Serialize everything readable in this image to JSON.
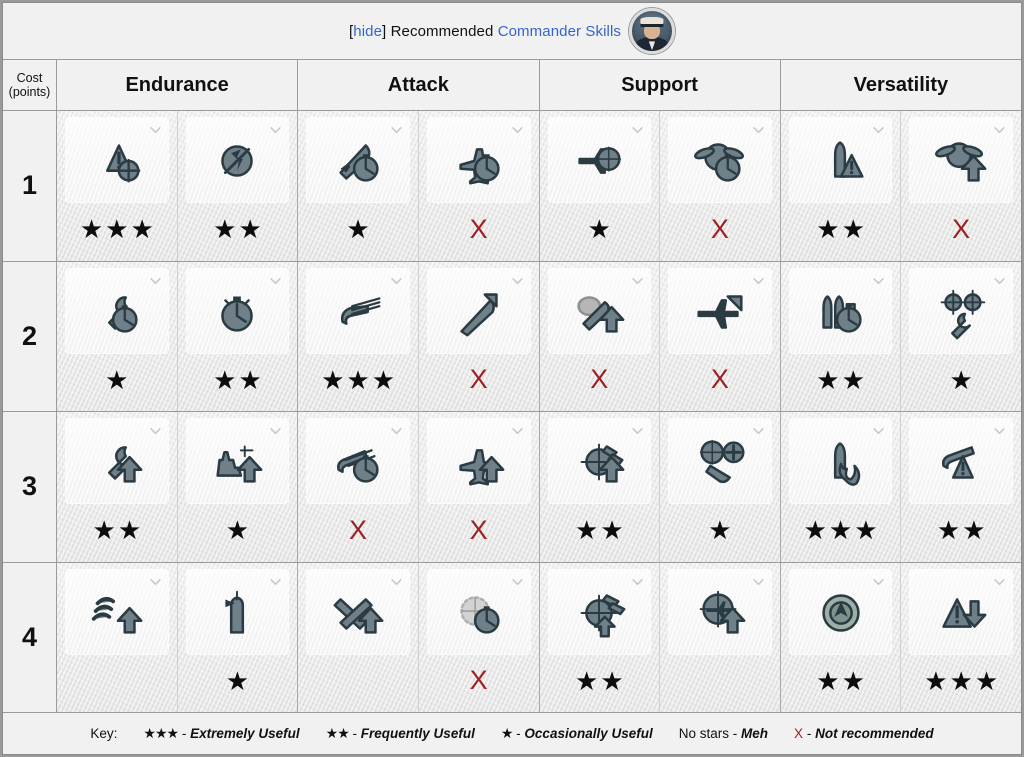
{
  "header": {
    "hide_label": "hide",
    "bracket_open": "[",
    "bracket_close": "]",
    "title_middle": " Recommended ",
    "link_label": "Commander Skills",
    "avatar_name": "commander-avatar",
    "link_color": "#3366cc"
  },
  "columns": {
    "cost_header_line1": "Cost",
    "cost_header_line2": "(points)",
    "categories": [
      "Endurance",
      "Attack",
      "Support",
      "Versatility"
    ]
  },
  "legend": {
    "key_label": "Key:",
    "items": [
      {
        "symbol": "★★★",
        "dash": "-",
        "desc": "Extremely Useful",
        "type": "stars"
      },
      {
        "symbol": "★★",
        "dash": "-",
        "desc": "Frequently Useful",
        "type": "stars"
      },
      {
        "symbol": "★",
        "dash": "-",
        "desc": "Occasionally Useful",
        "type": "stars"
      },
      {
        "symbol": "No stars",
        "dash": "-",
        "desc": "Meh",
        "type": "text"
      },
      {
        "symbol": "X",
        "dash": "-",
        "desc": "Not recommended",
        "type": "x"
      }
    ]
  },
  "colors": {
    "link": "#3366cc",
    "x_mark": "#9d1f1f",
    "star": "#0d0d0d",
    "grid_line": "#9b9b9b",
    "page_bg": "#9a9a9a",
    "panel_bg": "#f1f1f1",
    "icon_fill": "#6f8089",
    "icon_stroke": "#2b3b43"
  },
  "rows": [
    {
      "cost": "1",
      "cells": [
        {
          "icon": "priority-target-icon",
          "rating": "★★★",
          "stars": 3,
          "mark": ""
        },
        {
          "icon": "preventive-maintenance-icon",
          "rating": "★★",
          "stars": 2,
          "mark": ""
        },
        {
          "icon": "torpedo-armament-expertise-icon",
          "rating": "★",
          "stars": 1,
          "mark": ""
        },
        {
          "icon": "air-supremacy-icon",
          "rating": "X",
          "stars": 0,
          "mark": "X"
        },
        {
          "icon": "direction-center-for-fighters-icon",
          "rating": "★",
          "stars": 1,
          "mark": ""
        },
        {
          "icon": "improved-engine-boost-icon",
          "rating": "X",
          "stars": 0,
          "mark": "X"
        },
        {
          "icon": "incoming-fire-alert-icon",
          "rating": "★★",
          "stars": 2,
          "mark": ""
        },
        {
          "icon": "last-gasp-icon",
          "rating": "X",
          "stars": 0,
          "mark": "X"
        }
      ]
    },
    {
      "cost": "2",
      "cells": [
        {
          "icon": "emergency-repair-specialist-icon",
          "rating": "★",
          "stars": 1,
          "mark": ""
        },
        {
          "icon": "adrenaline-rush-icon",
          "rating": "★★",
          "stars": 2,
          "mark": ""
        },
        {
          "icon": "main-battery-expert-icon",
          "rating": "★★★",
          "stars": 3,
          "mark": ""
        },
        {
          "icon": "torpedo-acceleration-icon",
          "rating": "X",
          "stars": 0,
          "mark": "X"
        },
        {
          "icon": "smoke-screen-expert-icon",
          "rating": "X",
          "stars": 0,
          "mark": "X"
        },
        {
          "icon": "improved-engines-icon",
          "rating": "X",
          "stars": 0,
          "mark": "X"
        },
        {
          "icon": "expert-loader-icon",
          "rating": "★★",
          "stars": 2,
          "mark": ""
        },
        {
          "icon": "jack-of-all-trades-icon",
          "rating": "★",
          "stars": 1,
          "mark": ""
        }
      ]
    },
    {
      "cost": "3",
      "cells": [
        {
          "icon": "basics-of-survivability-icon",
          "rating": "★★",
          "stars": 2,
          "mark": ""
        },
        {
          "icon": "survivability-expert-icon",
          "rating": "★",
          "stars": 1,
          "mark": ""
        },
        {
          "icon": "main-battery-reload-icon",
          "rating": "X",
          "stars": 0,
          "mark": "X"
        },
        {
          "icon": "torpedo-bomber-icon",
          "rating": "X",
          "stars": 0,
          "mark": "X"
        },
        {
          "icon": "aircraft-armor-icon",
          "rating": "★★",
          "stars": 2,
          "mark": ""
        },
        {
          "icon": "aircraft-repair-icon",
          "rating": "★",
          "stars": 1,
          "mark": ""
        },
        {
          "icon": "demolition-expert-icon",
          "rating": "★★★",
          "stars": 3,
          "mark": ""
        },
        {
          "icon": "inertia-fuse-he-icon",
          "rating": "★★",
          "stars": 2,
          "mark": ""
        }
      ]
    },
    {
      "cost": "4",
      "cells": [
        {
          "icon": "fire-prevention-icon",
          "rating": "",
          "stars": 0,
          "mark": ""
        },
        {
          "icon": "concealment-expert-icon",
          "rating": "★",
          "stars": 1,
          "mark": ""
        },
        {
          "icon": "torpedo-protection-icon",
          "rating": "",
          "stars": 0,
          "mark": ""
        },
        {
          "icon": "radio-location-icon",
          "rating": "X",
          "stars": 0,
          "mark": "X"
        },
        {
          "icon": "sight-stabilization-icon",
          "rating": "★★",
          "stars": 2,
          "mark": ""
        },
        {
          "icon": "interceptor-icon",
          "rating": "",
          "stars": 0,
          "mark": ""
        },
        {
          "icon": "radar-sonar-icon",
          "rating": "★★",
          "stars": 2,
          "mark": ""
        },
        {
          "icon": "massive-aoe-icon",
          "rating": "★★★",
          "stars": 3,
          "mark": ""
        }
      ]
    }
  ]
}
